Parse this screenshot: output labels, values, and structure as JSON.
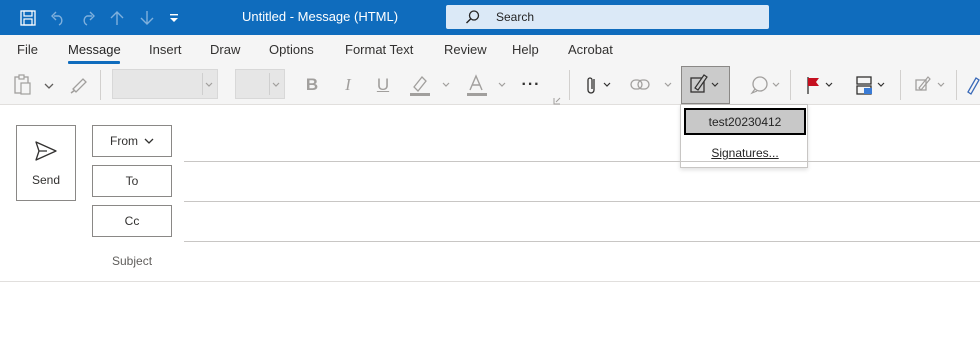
{
  "window": {
    "title": "Untitled  -  Message (HTML)",
    "search_placeholder": "Search"
  },
  "quick_access": [
    {
      "icon": "save-icon"
    },
    {
      "icon": "undo-icon"
    },
    {
      "icon": "redo-icon"
    },
    {
      "icon": "up-arrow-icon"
    },
    {
      "icon": "down-arrow-icon"
    },
    {
      "icon": "customize-toolbar-icon"
    }
  ],
  "tabs": [
    "File",
    "Message",
    "Insert",
    "Draw",
    "Options",
    "Format Text",
    "Review",
    "Help",
    "Acrobat"
  ],
  "active_tab": "Message",
  "ribbon": {
    "buttons": [
      "paste-icon",
      "format-painter-icon",
      "bold-icon",
      "italic-icon",
      "underline-icon",
      "highlight-icon",
      "font-color-icon",
      "more-icon",
      "attach-icon",
      "link-icon",
      "signature-icon",
      "loop-icon",
      "flag-icon",
      "assign-policy-icon",
      "sensitivity-icon",
      "editor-icon"
    ],
    "bold_glyph": "B",
    "italic_glyph": "I",
    "underline_glyph": "U",
    "more_glyph": "···"
  },
  "signature_menu": {
    "items": [
      "test20230412",
      "Signatures..."
    ],
    "selected": "test20230412"
  },
  "compose": {
    "send_label": "Send",
    "from_label": "From",
    "to_label": "To",
    "cc_label": "Cc",
    "subject_label": "Subject"
  },
  "colors": {
    "titlebar": "#0f6cbd",
    "accent": "#0f6cbd",
    "flag": "#c50f1f"
  }
}
